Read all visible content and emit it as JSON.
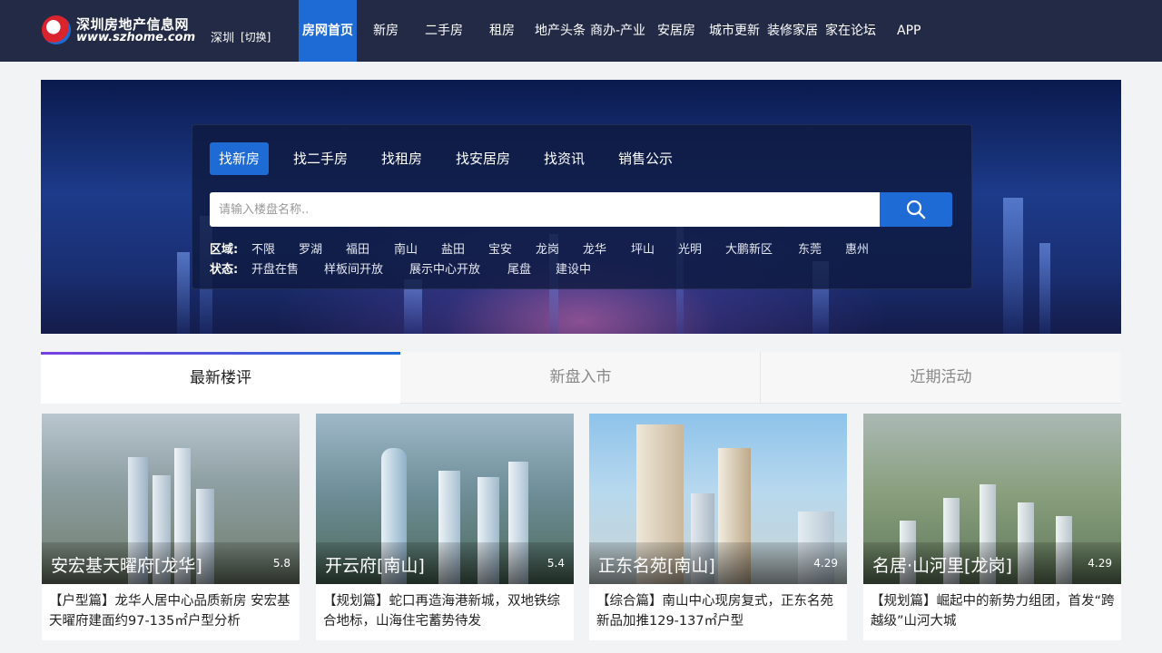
{
  "site": {
    "name_cn": "深圳房地产信息网",
    "name_en": "www.szhome.com",
    "city": "深圳",
    "city_switch": "[切换]"
  },
  "nav": [
    {
      "label": "房网首页",
      "active": true
    },
    {
      "label": "新房"
    },
    {
      "label": "二手房"
    },
    {
      "label": "租房"
    },
    {
      "label": "地产头条"
    },
    {
      "label": "商办-产业"
    },
    {
      "label": "安居房"
    },
    {
      "label": "城市更新"
    },
    {
      "label": "装修家居"
    },
    {
      "label": "家在论坛"
    },
    {
      "label": "APP"
    }
  ],
  "search": {
    "tabs": [
      "找新房",
      "找二手房",
      "找租房",
      "找安居房",
      "找资讯",
      "销售公示"
    ],
    "active_tab": "找新房",
    "placeholder": "请输入楼盘名称..",
    "area_label": "区域:",
    "areas": [
      "不限",
      "罗湖",
      "福田",
      "南山",
      "盐田",
      "宝安",
      "龙岗",
      "龙华",
      "坪山",
      "光明",
      "大鹏新区",
      "东莞",
      "惠州"
    ],
    "status_label": "状态:",
    "statuses": [
      "开盘在售",
      "样板间开放",
      "展示中心开放",
      "尾盘",
      "建设中"
    ]
  },
  "content_tabs": [
    "最新楼评",
    "新盘入市",
    "近期活动"
  ],
  "active_content_tab": "最新楼评",
  "cards": [
    {
      "title": "安宏基天曜府[龙华]",
      "date": "5.8",
      "desc": "【户型篇】龙华人居中心品质新房 安宏基天曜府建面约97-135㎡户型分析"
    },
    {
      "title": "开云府[南山]",
      "date": "5.4",
      "desc": "【规划篇】蛇口再造海港新城，双地铁综合地标，山海住宅蓄势待发"
    },
    {
      "title": "正东名苑[南山]",
      "date": "4.29",
      "desc": "【综合篇】南山中心现房复式，正东名苑新品加推129-137㎡户型"
    },
    {
      "title": "名居·山河里[龙岗]",
      "date": "4.29",
      "desc": "【规划篇】崛起中的新势力组团，首发“跨越级”山河大城"
    }
  ],
  "colors": {
    "topbar": "#232a45",
    "accent": "#1e6bd6",
    "banner": "#1d3b8a"
  },
  "icons": {
    "search": "search-icon",
    "logo": "logo-icon"
  }
}
